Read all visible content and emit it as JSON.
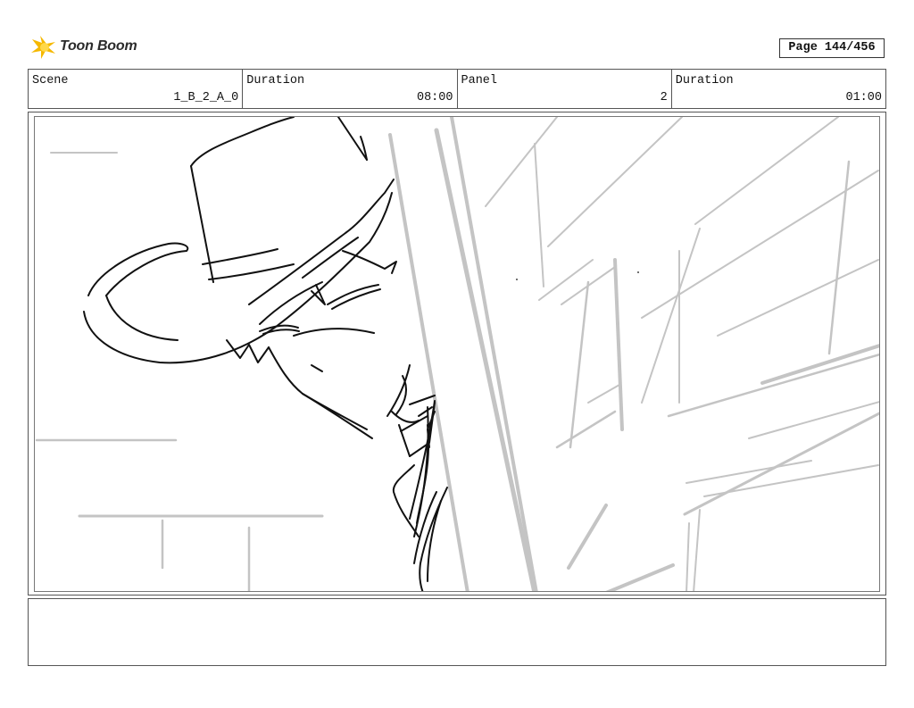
{
  "brand": {
    "name": "Toon Boom",
    "accent": "#f5b800"
  },
  "page": {
    "label": "Page 144/456"
  },
  "info": {
    "scene_label": "Scene",
    "scene_value": "1_B_2_A_0",
    "duration_label": "Duration",
    "duration_value": "08:00",
    "panel_label": "Panel",
    "panel_value": "2",
    "panel_duration_label": "Duration",
    "panel_duration_value": "01:00"
  },
  "colors": {
    "sketch": "#111111",
    "construction": "#c4c4c4",
    "border": "#555555"
  },
  "notes": {
    "text": ""
  }
}
